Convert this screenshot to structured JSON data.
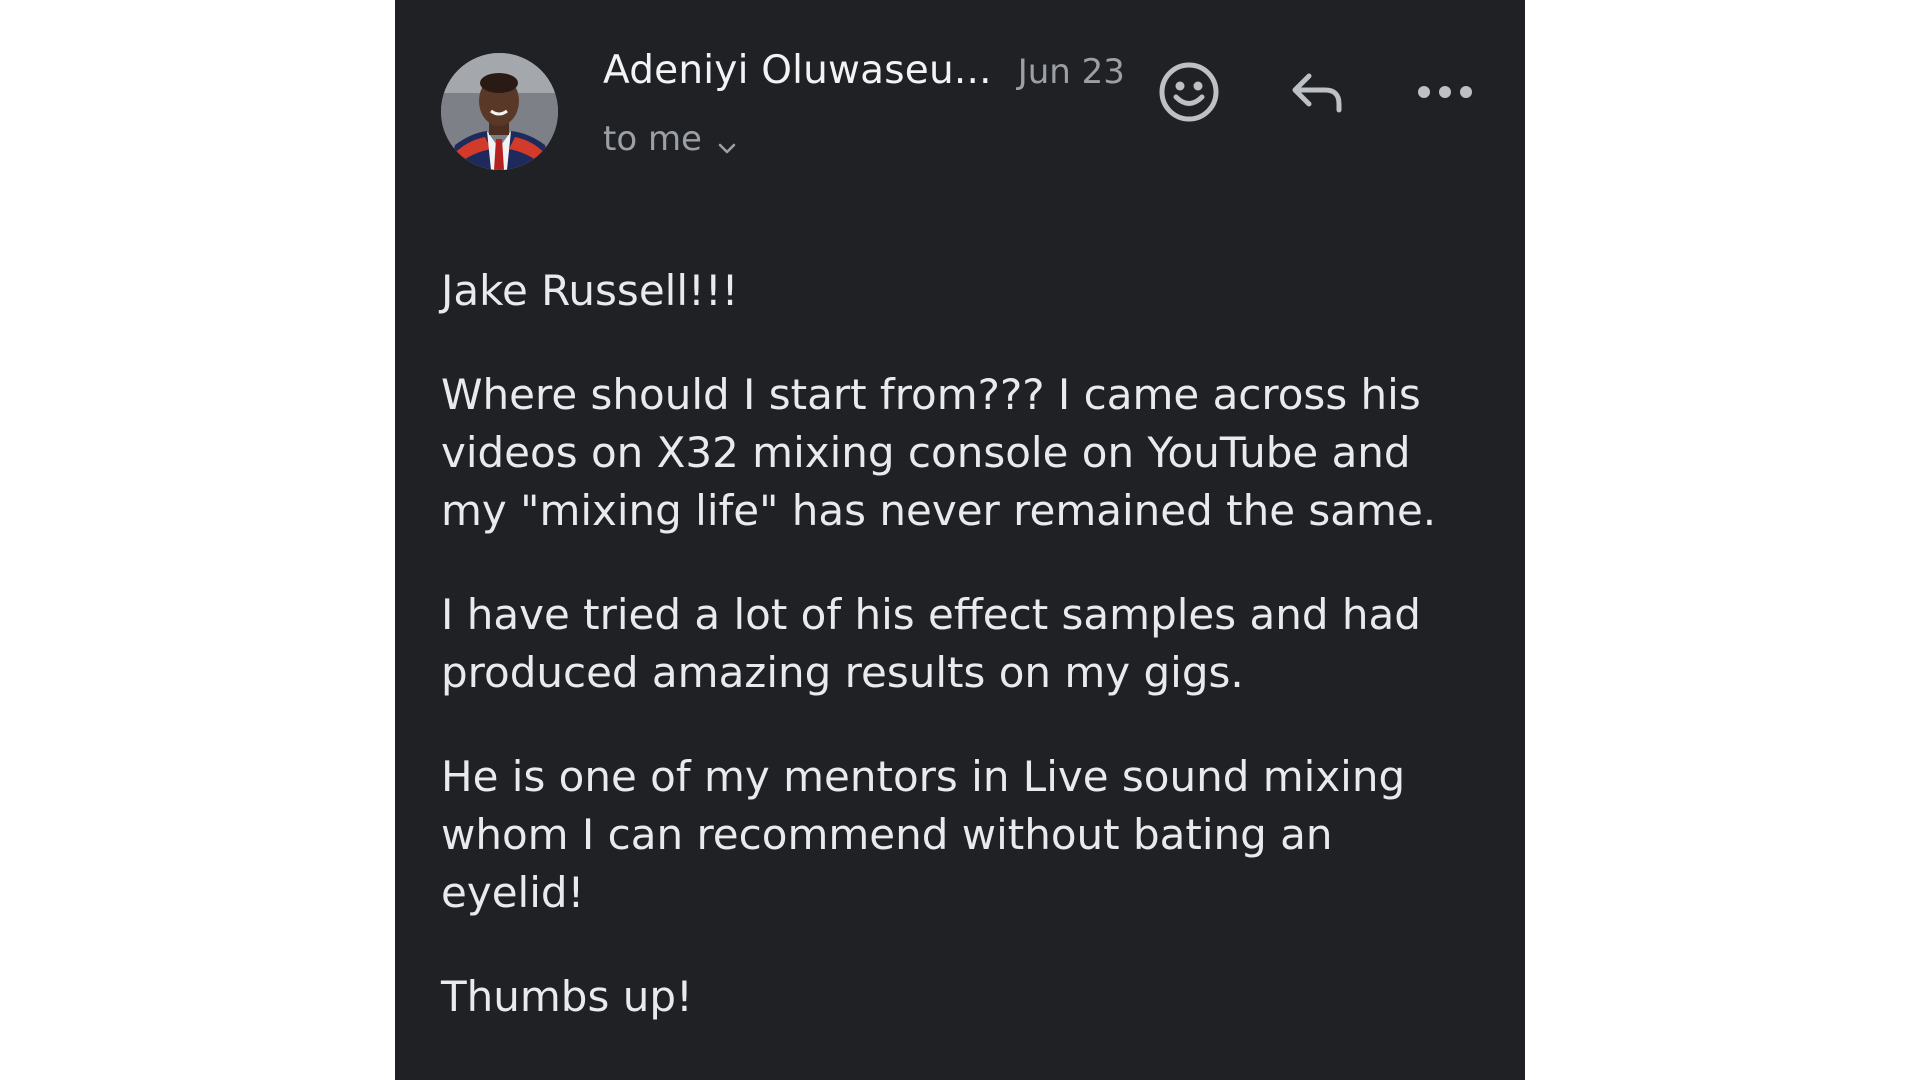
{
  "email": {
    "sender_name": "Adeniyi Oluwaseu...",
    "date": "Jun 23",
    "recipient": "to me",
    "icons": {
      "avatar": "sender-avatar-photo",
      "emoji": "smiley-face-icon",
      "reply": "reply-arrow-icon",
      "more": "more-horizontal-icon",
      "expand": "chevron-down-icon"
    },
    "body": {
      "greeting": "Jake Russell!!!",
      "paragraphs": [
        "Where should I start from??? I came across his videos on X32 mixing console on YouTube and my \"mixing life\" has never remained the same.",
        "I have tried a lot of his effect samples and had produced amazing results on my gigs.",
        "He is one of my mentors in Live sound mixing whom I can recommend without bating an eyelid!"
      ],
      "closing": "Thumbs up!"
    }
  },
  "colors": {
    "panel_background": "#202124",
    "page_background": "#ffffff",
    "primary_text": "#e8eaed",
    "secondary_text": "#9aa0a6"
  }
}
